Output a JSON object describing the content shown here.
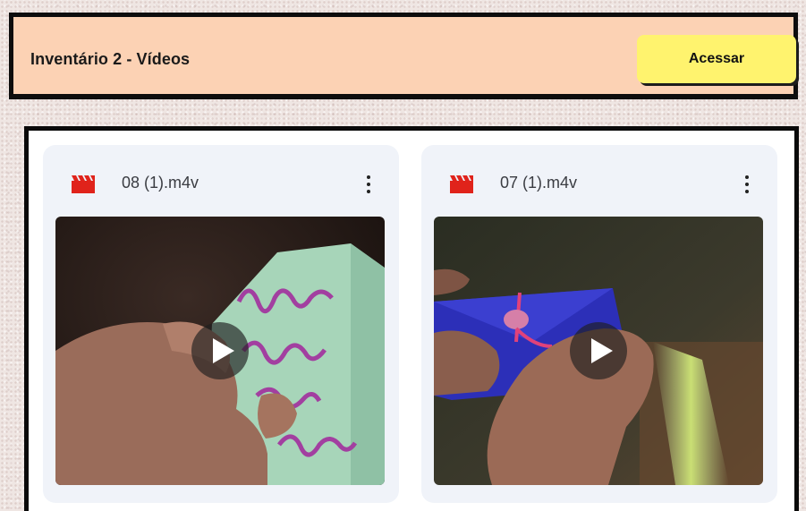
{
  "header": {
    "title": "Inventário 2 - Vídeos",
    "access_label": "Acessar"
  },
  "videos": [
    {
      "name": "08 (1).m4v",
      "icon": "video-file-icon",
      "menu_icon": "more-vertical-icon",
      "thumbnail": "hand holding green paper with handwritten poem"
    },
    {
      "name": "07 (1).m4v",
      "icon": "video-file-icon",
      "menu_icon": "more-vertical-icon",
      "thumbnail": "hands holding blue folded envelope with pink bead"
    }
  ],
  "colors": {
    "header_bg": "#fcd2b4",
    "button_bg": "#fff36e",
    "file_icon": "#e0231b",
    "card_bg": "#f0f3f9"
  }
}
